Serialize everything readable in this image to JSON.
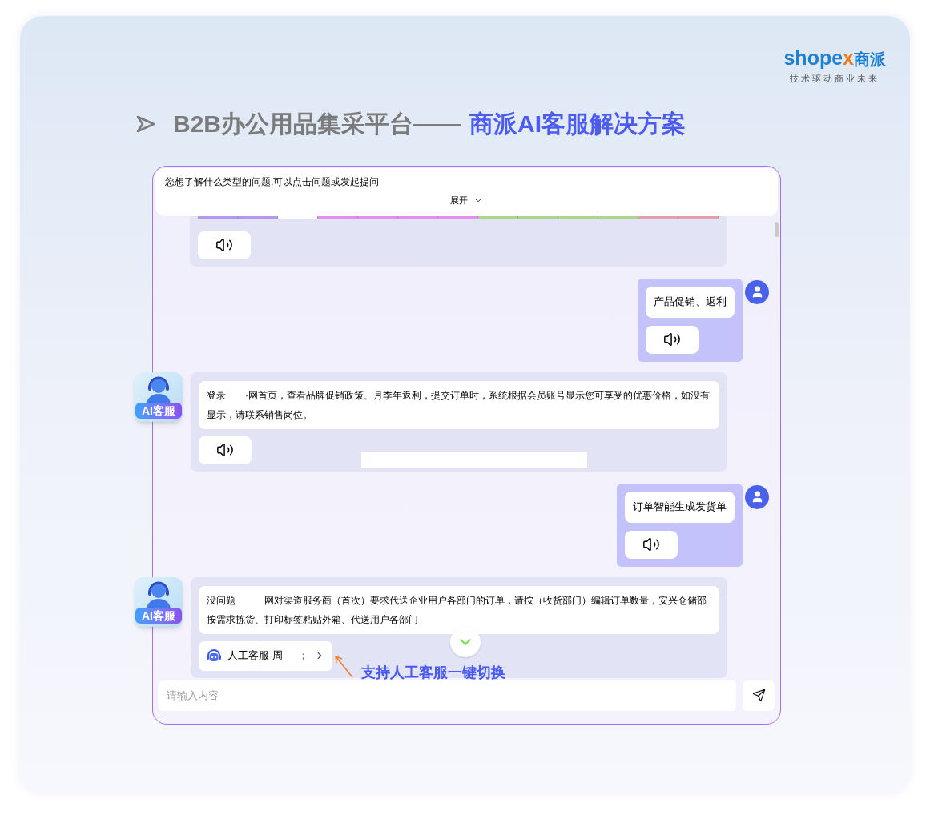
{
  "logo": {
    "wordmark_start": "shope",
    "wordmark_accent": "x",
    "wordmark_end": "商派",
    "tagline": "技术驱动商业未来"
  },
  "headline": {
    "lead": "B2B办公用品集采平台——",
    "highlight": "商派AI客服解决方案"
  },
  "chat": {
    "banner": {
      "prompt": "您想了解什么类型的问题,可以点击问题或发起提问",
      "expand_label": "展开"
    },
    "messages": [
      {
        "kind": "bot_partial"
      },
      {
        "kind": "user",
        "text": "产品促销、返利"
      },
      {
        "kind": "bot",
        "avatar_label": "AI客服",
        "text": "登录　　·网首页，查看品牌促销政策、月季年返利，提交订单时，系统根据会员账号显示您可享受的优惠价格，如没有显示，请联系销售岗位。"
      },
      {
        "kind": "user",
        "text": "订单智能生成发货单"
      },
      {
        "kind": "bot",
        "avatar_label": "AI客服",
        "text": "没问题　　　网对渠道服务商（首次）要求代送企业用户各部门的订单，请按（收货部门）编辑订单数量，安兴仓储部按需求拣货、打印标签粘贴外箱、代送用户各部门",
        "handoff": {
          "agent": "人工客服-周",
          "trailing": "；"
        }
      }
    ],
    "input": {
      "placeholder": "请输入内容"
    }
  },
  "callout": {
    "text": "支持人工客服一键切换"
  }
}
